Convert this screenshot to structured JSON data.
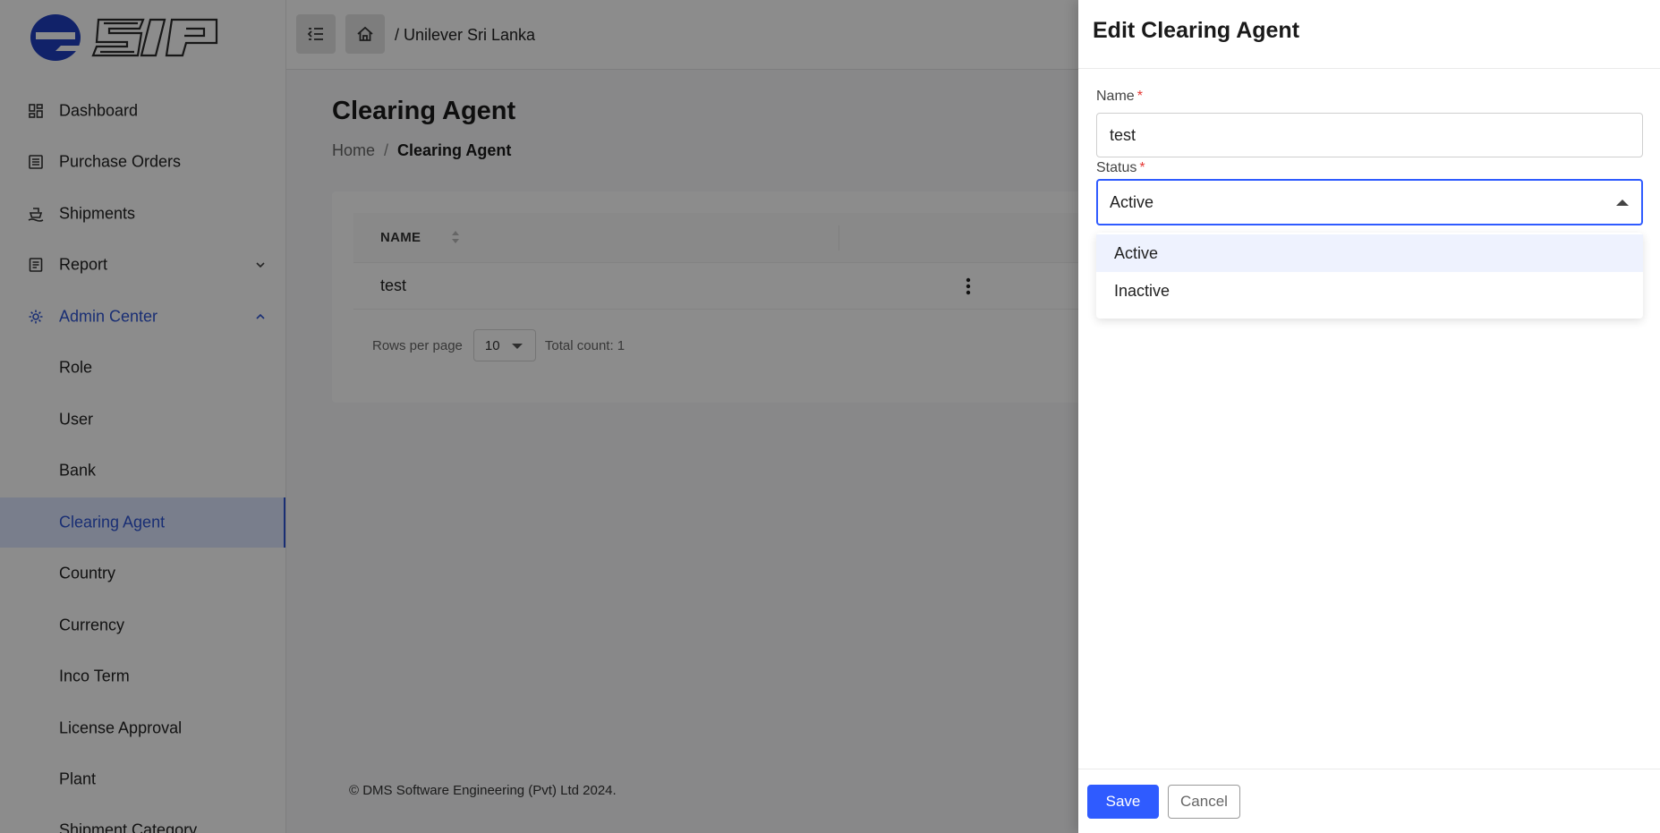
{
  "brand": {
    "logo_text": "eSIP",
    "accent": "#2f55d4",
    "primary_button": "#2f5bff"
  },
  "sidebar": {
    "items": [
      {
        "label": "Dashboard",
        "icon": "dashboard-icon"
      },
      {
        "label": "Purchase Orders",
        "icon": "list-icon"
      },
      {
        "label": "Shipments",
        "icon": "ship-icon"
      },
      {
        "label": "Report",
        "icon": "report-icon",
        "expandable": true,
        "expanded": false
      },
      {
        "label": "Admin Center",
        "icon": "gear-icon",
        "expandable": true,
        "expanded": true
      },
      {
        "label": "Role"
      },
      {
        "label": "User"
      },
      {
        "label": "Bank"
      },
      {
        "label": "Clearing Agent",
        "active": true
      },
      {
        "label": "Country"
      },
      {
        "label": "Currency"
      },
      {
        "label": "Inco Term"
      },
      {
        "label": "License Approval"
      },
      {
        "label": "Plant"
      },
      {
        "label": "Shipment Category"
      }
    ]
  },
  "topbar": {
    "breadcrumb": "/ Unilever Sri Lanka"
  },
  "page": {
    "title": "Clearing Agent",
    "breadcrumb": {
      "home": "Home",
      "separator": "/",
      "current": "Clearing Agent"
    }
  },
  "table": {
    "columns": [
      "NAME"
    ],
    "rows": [
      {
        "name": "test"
      }
    ],
    "pagination": {
      "rows_per_page_label": "Rows per page",
      "rows_per_page": "10",
      "total_count": "Total count: 1"
    }
  },
  "footer": {
    "copyright": "© DMS Software Engineering (Pvt) Ltd 2024."
  },
  "drawer": {
    "title": "Edit Clearing Agent",
    "name_label": "Name",
    "name_value": "test",
    "status_label": "Status",
    "status_value": "Active",
    "required_mark": "*",
    "status_options": [
      "Active",
      "Inactive"
    ],
    "save_label": "Save",
    "cancel_label": "Cancel"
  }
}
